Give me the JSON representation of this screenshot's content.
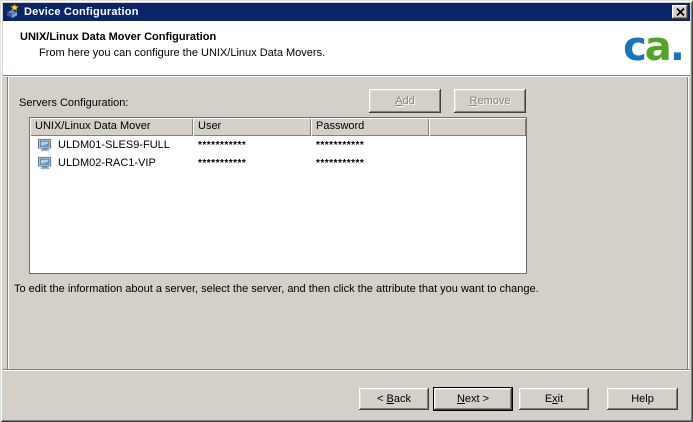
{
  "window": {
    "title": "Device Configuration"
  },
  "header": {
    "title": "UNIX/Linux Data Mover Configuration",
    "subtitle": "From here you can configure the UNIX/Linux Data Movers.",
    "logo": {
      "c": "c",
      "a": "a",
      "dot": "."
    }
  },
  "toolbar": {
    "servers_label": "Servers Configuration:",
    "add": {
      "mn": "A",
      "rest": "dd"
    },
    "remove": {
      "mn": "R",
      "rest": "emove"
    }
  },
  "table": {
    "columns": [
      "UNIX/Linux Data Mover",
      "User",
      "Password",
      ""
    ],
    "rows": [
      {
        "name": "ULDM01-SLES9-FULL",
        "user": "***********",
        "password": "***********"
      },
      {
        "name": "ULDM02-RAC1-VIP",
        "user": "***********",
        "password": "***********"
      }
    ]
  },
  "hint": "To edit the information about a server, select the server, and then click the attribute that you want to change.",
  "footer": {
    "back": {
      "pre": "< ",
      "mn": "B",
      "rest": "ack"
    },
    "next": {
      "pre": "",
      "mn": "N",
      "rest": "ext >"
    },
    "exit": {
      "pre": "E",
      "mn": "x",
      "rest": "it"
    },
    "help": "Help"
  },
  "colors": {
    "titlebar": "#0A246A",
    "dialog": "#D4D0C8",
    "logo_blue": "#1B75BC",
    "logo_green": "#52A427"
  }
}
